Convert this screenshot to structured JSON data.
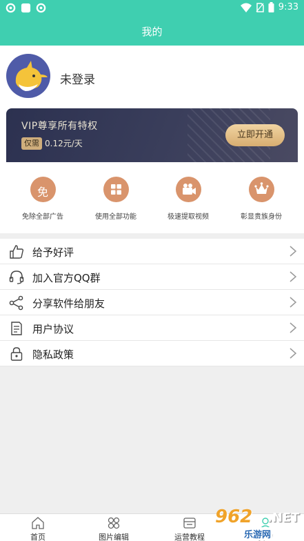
{
  "status_bar": {
    "time": "9:33"
  },
  "header": {
    "title": "我的"
  },
  "profile": {
    "login_status": "未登录"
  },
  "vip": {
    "title": "VIP尊享所有特权",
    "tag": "仅需",
    "price": "0.12元/天",
    "button_label": "立即开通"
  },
  "features": [
    {
      "label": "免除全部广告",
      "icon": "free-icon",
      "glyph": "免"
    },
    {
      "label": "使用全部功能",
      "icon": "grid-icon"
    },
    {
      "label": "极速提取视频",
      "icon": "video-camera-icon"
    },
    {
      "label": "彰显贵族身份",
      "icon": "crown-icon"
    }
  ],
  "menu": [
    {
      "label": "给予好评",
      "icon": "thumbs-up-icon"
    },
    {
      "label": "加入官方QQ群",
      "icon": "headset-icon"
    },
    {
      "label": "分享软件给朋友",
      "icon": "share-icon"
    },
    {
      "label": "用户协议",
      "icon": "document-icon"
    },
    {
      "label": "隐私政策",
      "icon": "lock-icon"
    }
  ],
  "bottom_nav": [
    {
      "label": "首页",
      "icon": "home-icon"
    },
    {
      "label": "图片编辑",
      "icon": "image-edit-icon"
    },
    {
      "label": "运营教程",
      "icon": "tutorial-icon"
    },
    {
      "label": "我的",
      "icon": "profile-icon"
    }
  ],
  "watermark": {
    "big": "962",
    "net": ".NET",
    "small": "乐游网"
  },
  "colors": {
    "primary": "#3fcfb0",
    "feature_icon": "#d9946c",
    "vip_dark": "#2c3150",
    "vip_gold": "#d7ad71"
  }
}
